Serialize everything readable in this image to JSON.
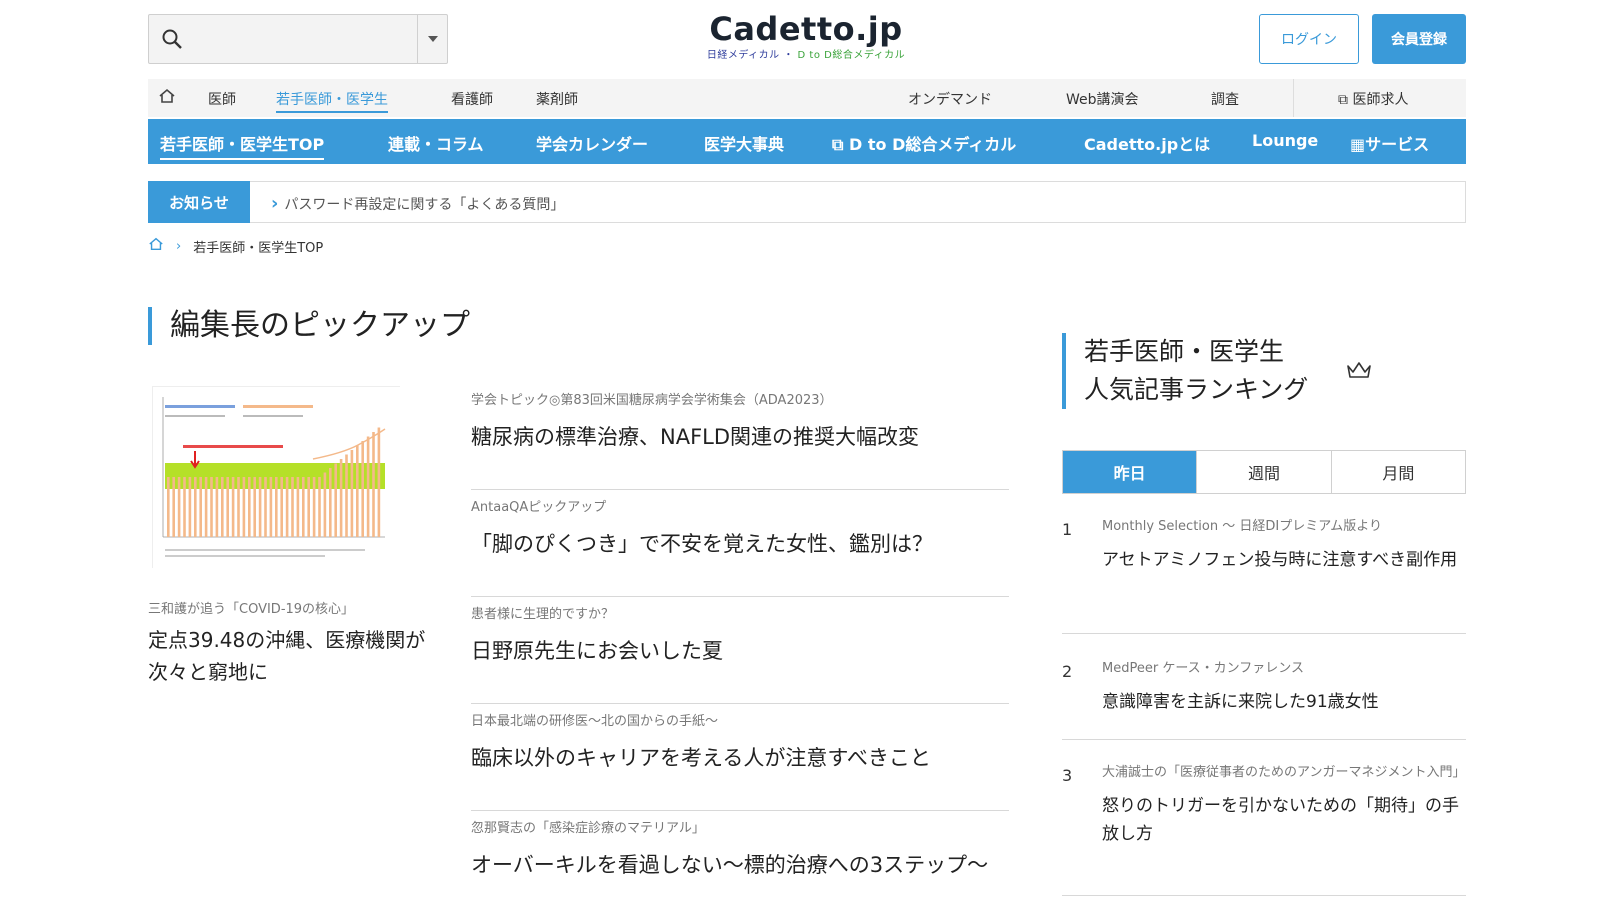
{
  "header": {
    "logo_text": "Cadetto.jp",
    "logo_sub_a": "日経メディカル",
    "logo_sub_b": "D to D総合メディカル",
    "login_label": "ログイン",
    "register_label": "会員登録"
  },
  "topnav": {
    "items": [
      "医師",
      "若手医師・医学生",
      "看護師",
      "薬剤師",
      "オンデマンド",
      "Web講演会",
      "調査",
      "医師求人"
    ]
  },
  "bluenav": {
    "items": [
      "若手医師・医学生TOP",
      "連載・コラム",
      "学会カレンダー",
      "医学大事典",
      "D to D総合メディカル",
      "Cadetto.jpとは",
      "Lounge",
      "サービス"
    ]
  },
  "notice": {
    "tag": "お知らせ",
    "message": "パスワード再設定に関する「よくある質問」"
  },
  "breadcrumb": {
    "current": "若手医師・医学生TOP"
  },
  "picks": {
    "heading": "編集長のピックアップ",
    "feature": {
      "label": "三和護が追う「COVID-19の核心」",
      "title": "定点39.48の沖縄、医療機関が次々と窮地に"
    },
    "items": [
      {
        "label": "学会トピック◎第83回米国糖尿病学会学術集会（ADA2023）",
        "title": "糖尿病の標準治療、NAFLD関連の推奨大幅改変"
      },
      {
        "label": "AntaaQAピックアップ",
        "title": "「脚のぴくつき」で不安を覚えた女性、鑑別は？"
      },
      {
        "label": "患者様に生理的ですか？",
        "title": "日野原先生にお会いした夏"
      },
      {
        "label": "日本最北端の研修医〜北の国からの手紙〜",
        "title": "臨床以外のキャリアを考える人が注意すべきこと"
      },
      {
        "label": "忽那賢志の「感染症診療のマテリアル」",
        "title": "オーバーキルを看過しない〜標的治療への3ステップ〜"
      }
    ]
  },
  "ranking": {
    "heading_line1": "若手医師・医学生",
    "heading_line2": "人気記事ランキング",
    "tabs": [
      "昨日",
      "週間",
      "月間"
    ],
    "items": [
      {
        "num": "1",
        "label": "Monthly Selection 〜 日経DIプレミアム版より",
        "title": "アセトアミノフェン投与時に注意すべき副作用"
      },
      {
        "num": "2",
        "label": "MedPeer ケース・カンファレンス",
        "title": "意識障害を主訴に来院した91歳女性"
      },
      {
        "num": "3",
        "label": "大浦誠士の「医療従事者のためのアンガーマネジメント入門」",
        "title": "怒りのトリガーを引かないための「期待」の手放し方"
      }
    ]
  },
  "colors": {
    "accent": "#3a9ad9",
    "chart_band": "#b5e028",
    "chart_bar": "#f4b98a"
  }
}
